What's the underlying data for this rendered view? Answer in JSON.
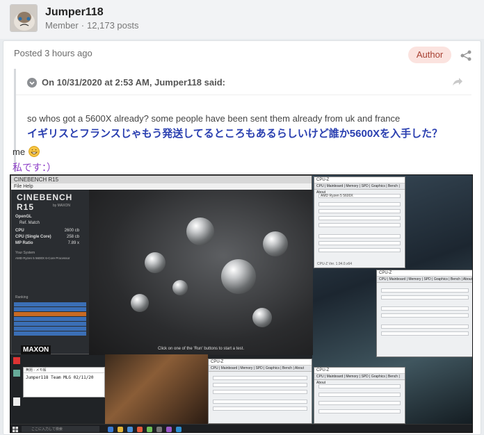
{
  "author": {
    "username": "Jumper118",
    "rank": "Member",
    "post_count": "12,173 posts"
  },
  "post": {
    "posted_label": "Posted 3 hours ago",
    "author_badge": "Author",
    "quote": {
      "header": "On 10/31/2020 at 2:53 AM, Jumper118 said:",
      "text_en": "so whos got a 5600X already? some people have been sent them already from uk and france",
      "text_jp": "イギリスとフランスじゃもう発送してるところもあるらしいけど誰か5600Xを入手した？"
    },
    "reply_en": "me",
    "reply_jp": "私です：）"
  },
  "screenshot": {
    "cinebench": {
      "window_title": "CINEBENCH R15",
      "menu": "File  Help",
      "logo": "CINEBENCH R15",
      "by": "by MAXON",
      "opengl_label": "OpenGL",
      "ref_match_label": "Ref. Match",
      "cpu_label": "CPU",
      "cpu_score": "2600 cb",
      "cpu_single_label": "CPU (Single Core)",
      "cpu_single_score": "258 cb",
      "mp_ratio_label": "MP Ratio",
      "mp_ratio": "7.89 x",
      "your_system": "Your System",
      "processor": "AMD Ryzen 5 5600X 6-Core Processor",
      "ranking": "Ranking",
      "maxon": "MAXON",
      "footer": "Click on one of the 'Run' buttons to start a test."
    },
    "cpuz": {
      "title": "CPU-Z",
      "tabs": "CPU | Mainboard | Memory | SPD | Graphics | Bench | About",
      "name": "AMD Ryzen 5 5600X",
      "version": "CPU-Z  Ver. 1.94.0.x64"
    },
    "notepad": {
      "title": "無題 - メモ帳",
      "text": "Jumper118 Team MLG 02/11/20"
    },
    "search_placeholder": "ここに入力して検索"
  }
}
